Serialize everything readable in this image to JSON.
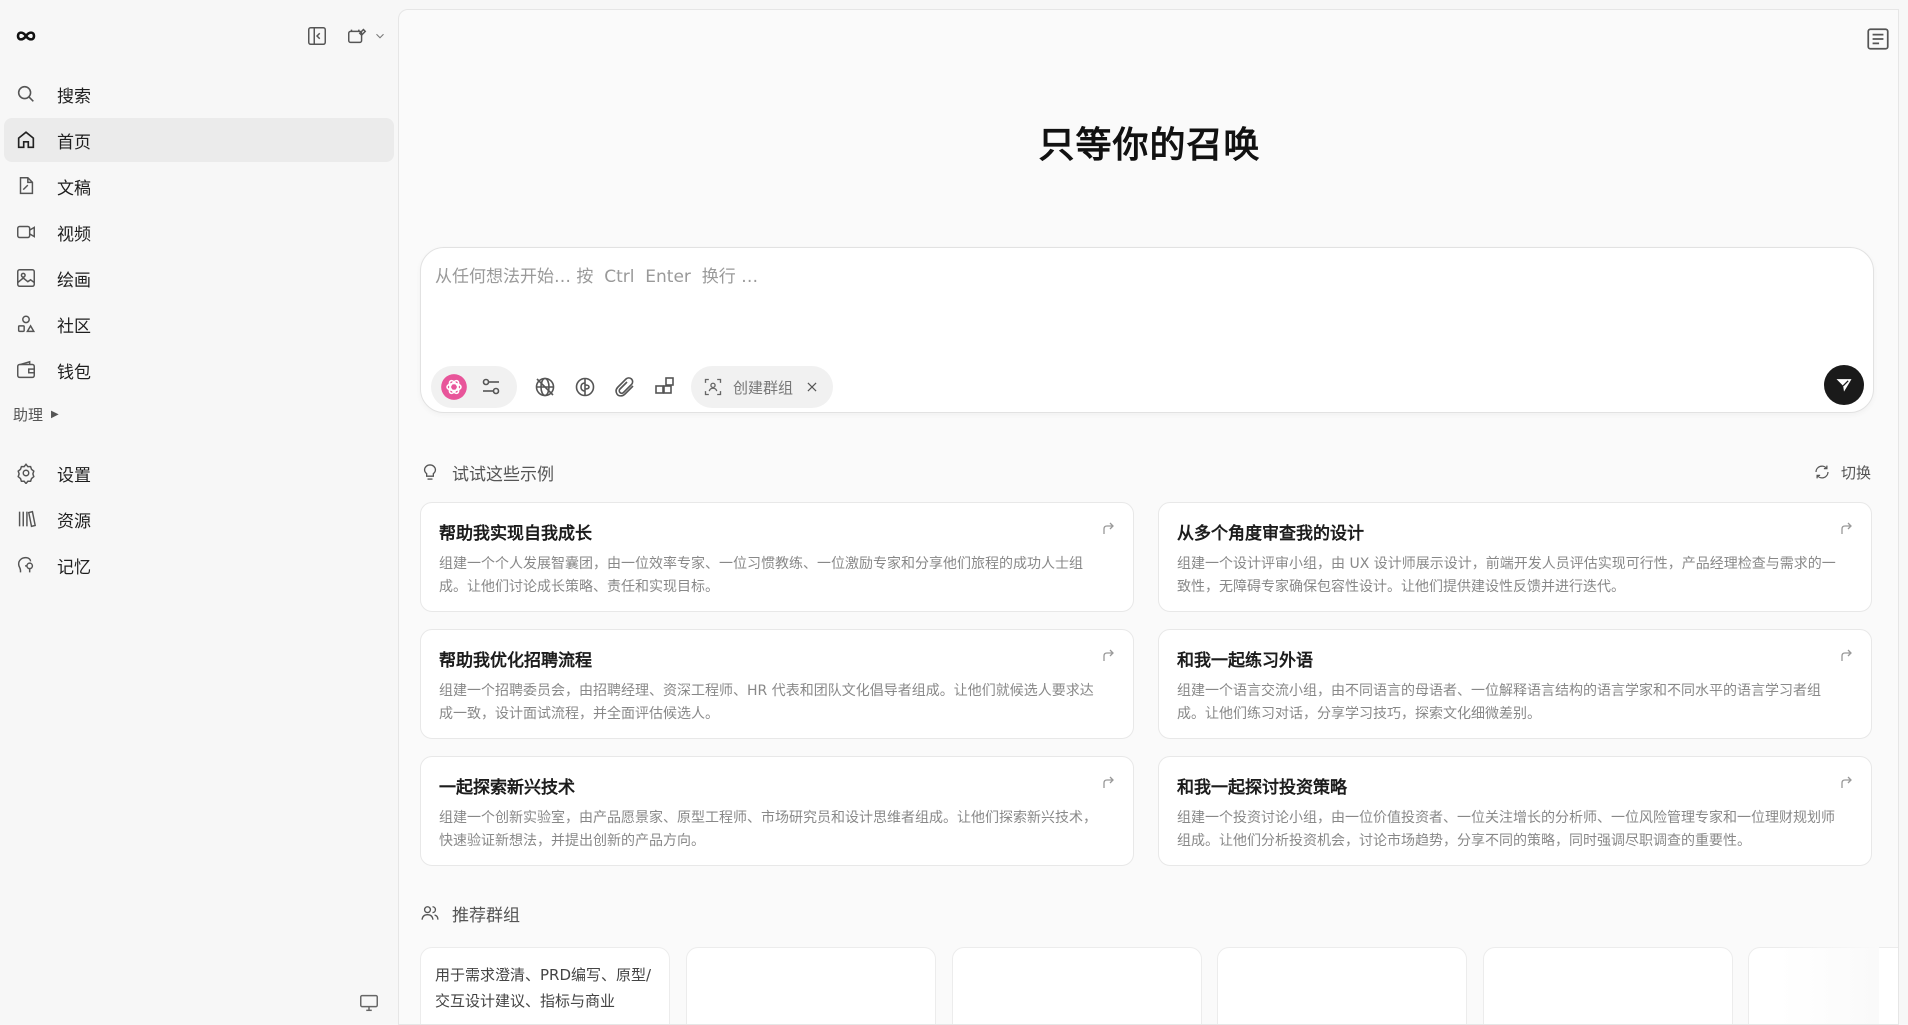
{
  "sidebar": {
    "nav": [
      {
        "label": "搜索",
        "icon": "search-icon"
      },
      {
        "label": "首页",
        "icon": "home-icon",
        "active": true
      },
      {
        "label": "文稿",
        "icon": "document-icon"
      },
      {
        "label": "视频",
        "icon": "video-icon"
      },
      {
        "label": "绘画",
        "icon": "image-icon"
      },
      {
        "label": "社区",
        "icon": "community-icon"
      },
      {
        "label": "钱包",
        "icon": "wallet-icon"
      }
    ],
    "section_label": "助理",
    "nav2": [
      {
        "label": "设置",
        "icon": "gear-icon"
      },
      {
        "label": "资源",
        "icon": "library-icon"
      },
      {
        "label": "记忆",
        "icon": "memory-icon"
      }
    ]
  },
  "main": {
    "hero_title": "只等你的召唤",
    "composer": {
      "placeholder": "从任何想法开始… 按  Ctrl  Enter  换行 …",
      "group_chip_label": "创建群组"
    },
    "examples": {
      "heading": "试试这些示例",
      "switch_label": "切换",
      "cards": [
        {
          "title": "帮助我实现自我成长",
          "desc": "组建一个个人发展智囊团，由一位效率专家、一位习惯教练、一位激励专家和分享他们旅程的成功人士组成。让他们讨论成长策略、责任和实现目标。"
        },
        {
          "title": "从多个角度审查我的设计",
          "desc": "组建一个设计评审小组，由 UX 设计师展示设计，前端开发人员评估实现可行性，产品经理检查与需求的一致性，无障碍专家确保包容性设计。让他们提供建设性反馈并进行迭代。"
        },
        {
          "title": "帮助我优化招聘流程",
          "desc": "组建一个招聘委员会，由招聘经理、资深工程师、HR 代表和团队文化倡导者组成。让他们就候选人要求达成一致，设计面试流程，并全面评估候选人。"
        },
        {
          "title": "和我一起练习外语",
          "desc": "组建一个语言交流小组，由不同语言的母语者、一位解释语言结构的语言学家和不同水平的语言学习者组成。让他们练习对话，分享学习技巧，探索文化细微差别。"
        },
        {
          "title": "一起探索新兴技术",
          "desc": "组建一个创新实验室，由产品愿景家、原型工程师、市场研究员和设计思维者组成。让他们探索新兴技术，快速验证新想法，并提出创新的产品方向。"
        },
        {
          "title": "和我一起探讨投资策略",
          "desc": "组建一个投资讨论小组，由一位价值投资者、一位关注增长的分析师、一位风险管理专家和一位理财规划师组成。让他们分析投资机会，讨论市场趋势，分享不同的策略，同时强调尽职调查的重要性。"
        }
      ]
    },
    "groups": {
      "heading": "推荐群组",
      "items": [
        {
          "desc": "用于需求澄清、PRD编写、原型/交互设计建议、指标与商业"
        },
        {
          "desc": ""
        },
        {
          "desc": ""
        },
        {
          "desc": ""
        },
        {
          "desc": ""
        },
        {
          "desc": ""
        }
      ]
    }
  },
  "colors": {
    "sidebar_bg": "#f7f7f7",
    "main_bg": "#fafafa",
    "active_nav": "#ebebeb",
    "send_button": "#1a1a1a",
    "model_accent": "#e8559a"
  }
}
